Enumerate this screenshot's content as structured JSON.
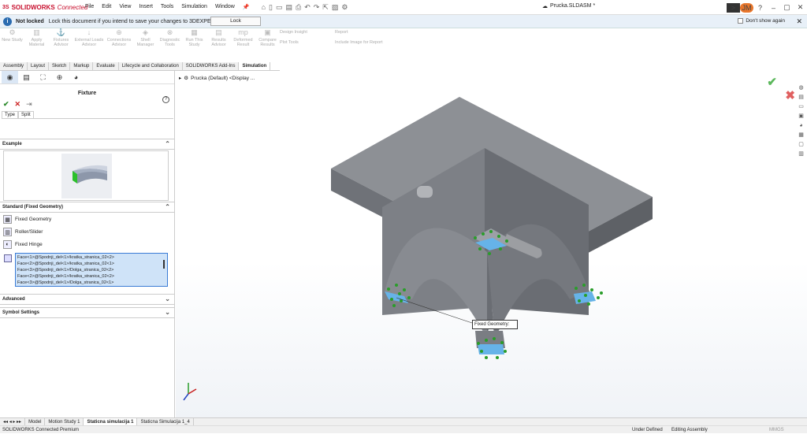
{
  "app": {
    "logo_ds": "3S",
    "logo": "SOLIDWORKS",
    "logo_suffix": "Connected",
    "menu": [
      "File",
      "Edit",
      "View",
      "Insert",
      "Tools",
      "Simulation",
      "Window"
    ],
    "filename": "Prucka.SLDASM *",
    "avatar": "JM"
  },
  "notice": {
    "title": "Not locked",
    "message": "Lock this document if you intend to save your changes to 3DEXPERIENCE.",
    "lock_button": "Lock",
    "dont_show": "Don't show again"
  },
  "commands": [
    {
      "label": "New Study",
      "icon": "⚙"
    },
    {
      "label": "Apply Material",
      "icon": "▥"
    },
    {
      "label": "Fixtures Advisor",
      "icon": "⚓"
    },
    {
      "label": "External Loads Advisor",
      "icon": "↓"
    },
    {
      "label": "Connections Advisor",
      "icon": "⊕"
    },
    {
      "label": "Shell Manager",
      "icon": "◈"
    },
    {
      "label": "Diagnostic Tools",
      "icon": "⊗"
    },
    {
      "label": "Run This Study",
      "icon": "▦"
    },
    {
      "label": "Results Advisor",
      "icon": "▤"
    },
    {
      "label": "Deformed Result",
      "icon": "mp"
    },
    {
      "label": "Compare Results",
      "icon": "▣"
    }
  ],
  "commands_small": {
    "design_insight": "Design Insight",
    "plot_tools": "Plot Tools",
    "report": "Report",
    "include_image": "Include Image for Report"
  },
  "tabs": [
    "Assembly",
    "Layout",
    "Sketch",
    "Markup",
    "Evaluate",
    "Lifecycle and Collaboration",
    "SOLIDWORKS Add-Ins",
    "Simulation"
  ],
  "panel": {
    "title": "Fixture",
    "type_tabs": [
      "Type",
      "Split"
    ],
    "example_header": "Example",
    "standard_header": "Standard (Fixed Geometry)",
    "options": [
      "Fixed Geometry",
      "Roller/Slider",
      "Fixed Hinge"
    ],
    "faces": [
      "Face<1>@Spodnji_del<1>/kratka_stranica_02<2>",
      "Face<2>@Spodnji_del<1>/kratka_stranica_02<1>",
      "Face<3>@Spodnji_del<1>/Dolga_stranica_02<2>",
      "Face<2>@Spodnji_del<1>/kratka_stranica_02<2>",
      "Face<3>@Spodnji_del<1>/Dolga_stranica_02<1>"
    ],
    "advanced_header": "Advanced",
    "symbol_header": "Symbol Settings"
  },
  "viewport": {
    "tree_label": "Prucka (Default) <Display ...",
    "callout": "Fixed Geometry:"
  },
  "bottom_tabs": [
    "Model",
    "Motion Study 1",
    "Staticna simulacija 1",
    "Staticna Simulacija 1_4"
  ],
  "status": {
    "product": "SOLIDWORKS Connected Premium",
    "state1": "Under Defined",
    "state2": "Editing Assembly",
    "units": "MMGS"
  },
  "colors": {
    "brand": "#c8102e",
    "selection": "#cfe3f8",
    "model_gray": "#7f8287",
    "fixture_green": "#2a9d2a"
  }
}
